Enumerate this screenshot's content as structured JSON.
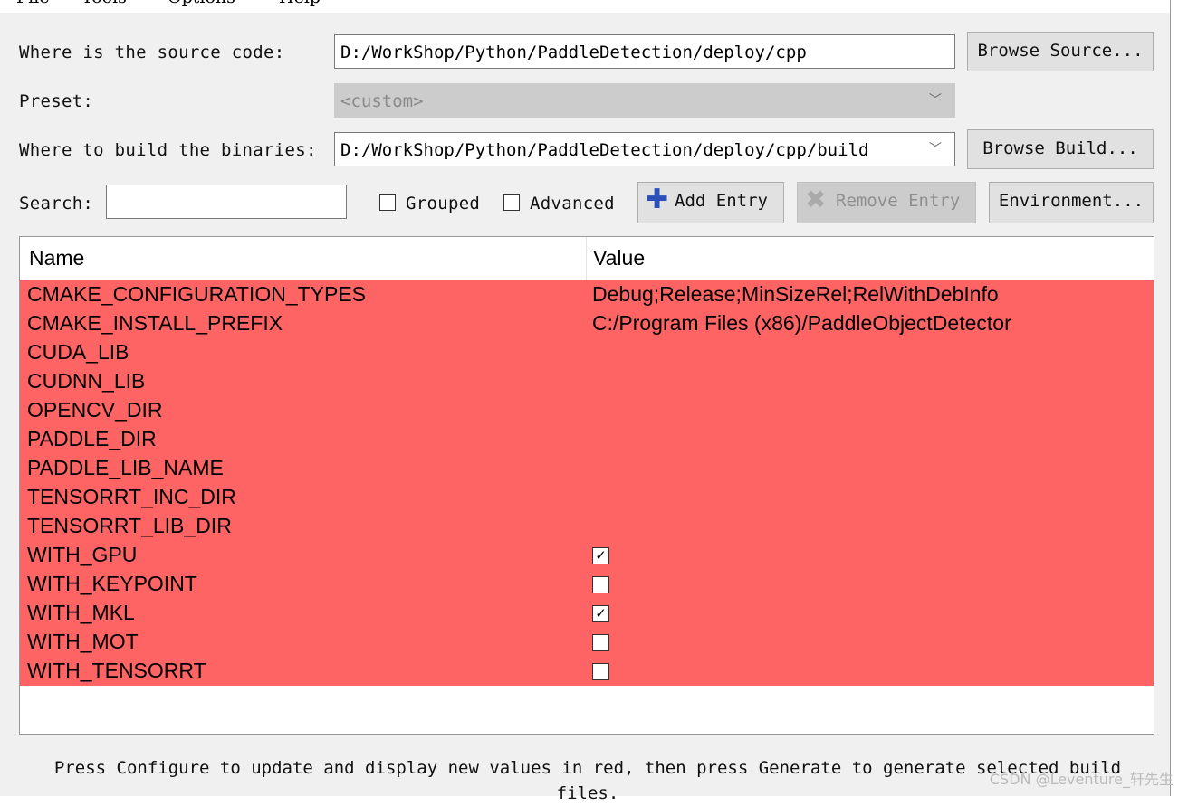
{
  "menu": [
    "File",
    "Tools",
    "Options",
    "Help"
  ],
  "source": {
    "label": "Where is the source code:",
    "value": "D:/WorkShop/Python/PaddleDetection/deploy/cpp",
    "browse": "Browse Source..."
  },
  "preset": {
    "label": "Preset:",
    "value": "<custom>"
  },
  "build": {
    "label": "Where to build the binaries:",
    "value": "D:/WorkShop/Python/PaddleDetection/deploy/cpp/build",
    "browse": "Browse Build..."
  },
  "toolbar": {
    "search_label": "Search:",
    "search_value": "",
    "grouped": "Grouped",
    "advanced": "Advanced",
    "add_entry": "Add Entry",
    "remove_entry": "Remove Entry",
    "environment": "Environment..."
  },
  "table": {
    "headers": [
      "Name",
      "Value"
    ],
    "rows": [
      {
        "name": "CMAKE_CONFIGURATION_TYPES",
        "value": "Debug;Release;MinSizeRel;RelWithDebInfo"
      },
      {
        "name": "CMAKE_INSTALL_PREFIX",
        "value": "C:/Program Files (x86)/PaddleObjectDetector"
      },
      {
        "name": "CUDA_LIB",
        "value": ""
      },
      {
        "name": "CUDNN_LIB",
        "value": ""
      },
      {
        "name": "OPENCV_DIR",
        "value": ""
      },
      {
        "name": "PADDLE_DIR",
        "value": ""
      },
      {
        "name": "PADDLE_LIB_NAME",
        "value": ""
      },
      {
        "name": "TENSORRT_INC_DIR",
        "value": ""
      },
      {
        "name": "TENSORRT_LIB_DIR",
        "value": ""
      },
      {
        "name": "WITH_GPU",
        "checked": true
      },
      {
        "name": "WITH_KEYPOINT",
        "checked": false
      },
      {
        "name": "WITH_MKL",
        "checked": true
      },
      {
        "name": "WITH_MOT",
        "checked": false
      },
      {
        "name": "WITH_TENSORRT",
        "checked": false
      }
    ]
  },
  "status": "Press Configure to update and display new values in red, then press Generate to generate selected build files.",
  "watermark": "CSDN @Leventure_轩先生",
  "colors": {
    "new_value_row": "#ff6464"
  }
}
